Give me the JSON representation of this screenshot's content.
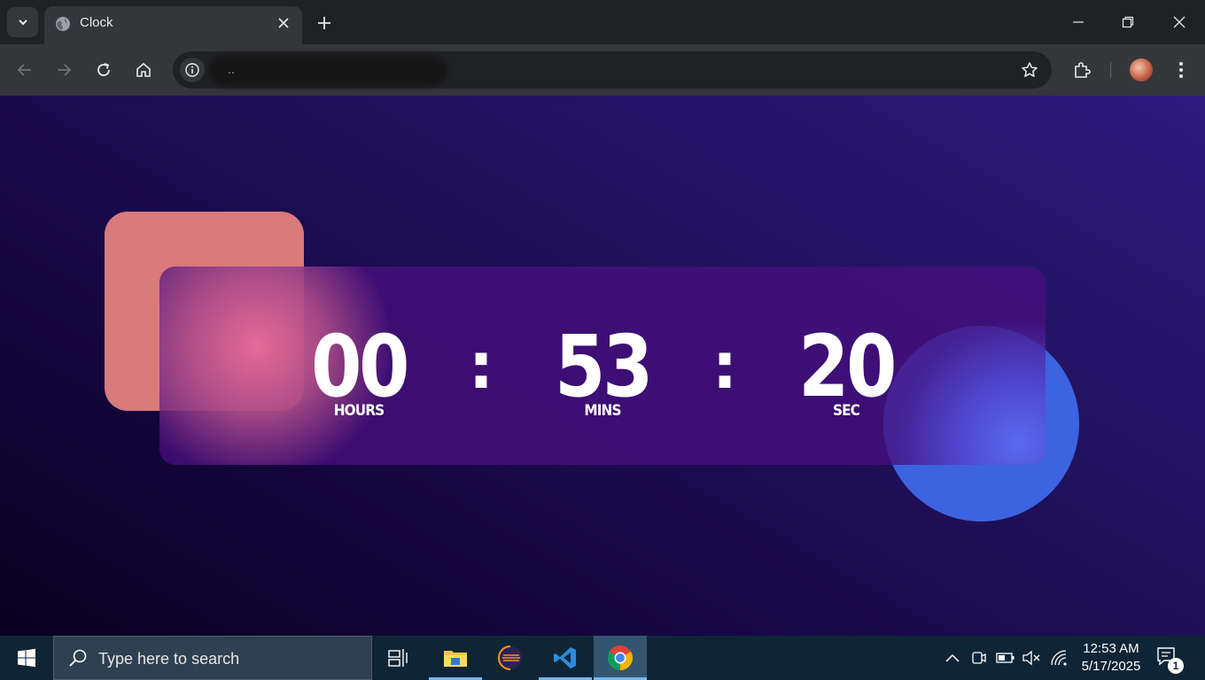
{
  "browser": {
    "tab_title": "Clock",
    "url_text": "..",
    "new_tab_symbol": "+"
  },
  "clock": {
    "hours": "00",
    "minutes": "53",
    "seconds": "20",
    "separator": ":",
    "labels": {
      "hours": "HOURS",
      "minutes": "MINS",
      "seconds": "SEC"
    }
  },
  "taskbar": {
    "search_placeholder": "Type here to search",
    "time": "12:53 AM",
    "date": "5/17/2025",
    "notification_count": "1",
    "apps": [
      "task-view",
      "file-explorer",
      "eclipse",
      "visual-studio-code",
      "google-chrome"
    ]
  },
  "colors": {
    "square_shape": "#d97a7b",
    "circle_shape": "#3d63e0",
    "card": "#46107d",
    "page_bg_dark": "#08001f",
    "page_bg_light": "#2c1a7e"
  }
}
